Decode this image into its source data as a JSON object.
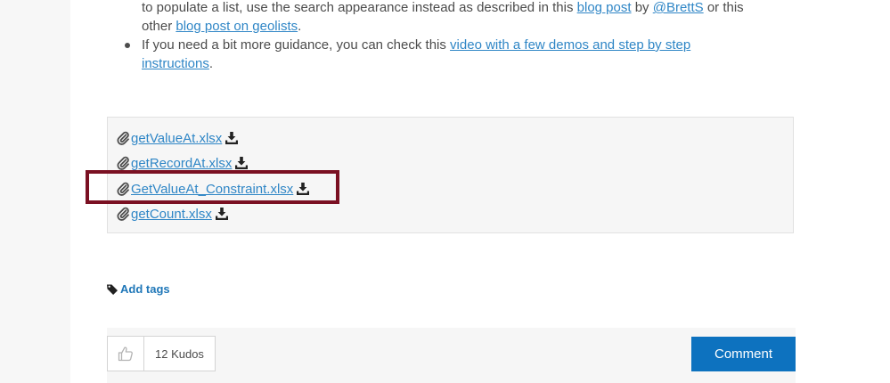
{
  "bullets": {
    "item1": {
      "line1_pre": "to populate a list, use the search appearance instead as described in this ",
      "blog_post_link": "blog post",
      "by_text": " by ",
      "author_link": "@BrettS",
      "line1_post": " or this",
      "line2_pre": "other ",
      "geolists_link": "blog post on geolists",
      "line2_post": "."
    },
    "item2": {
      "pre": "If you need a bit more guidance, you can check this ",
      "video_link_line1": "video with a few demos and step by step",
      "video_link_line2": "instructions",
      "post": "."
    }
  },
  "attachments": [
    {
      "name": "getValueAt.xlsx"
    },
    {
      "name": "getRecordAt.xlsx"
    },
    {
      "name": "GetValueAt_Constraint.xlsx"
    },
    {
      "name": "getCount.xlsx"
    }
  ],
  "tags": {
    "label": "Add tags",
    "icon": "tag-icon"
  },
  "footer": {
    "kudos_count": "12 Kudos",
    "kudo_icon": "thumbs-up-icon",
    "comment_label": "Comment"
  },
  "colors": {
    "link": "#2f86c6",
    "highlight_border": "#7a1022",
    "comment_button": "#0d72bf"
  }
}
